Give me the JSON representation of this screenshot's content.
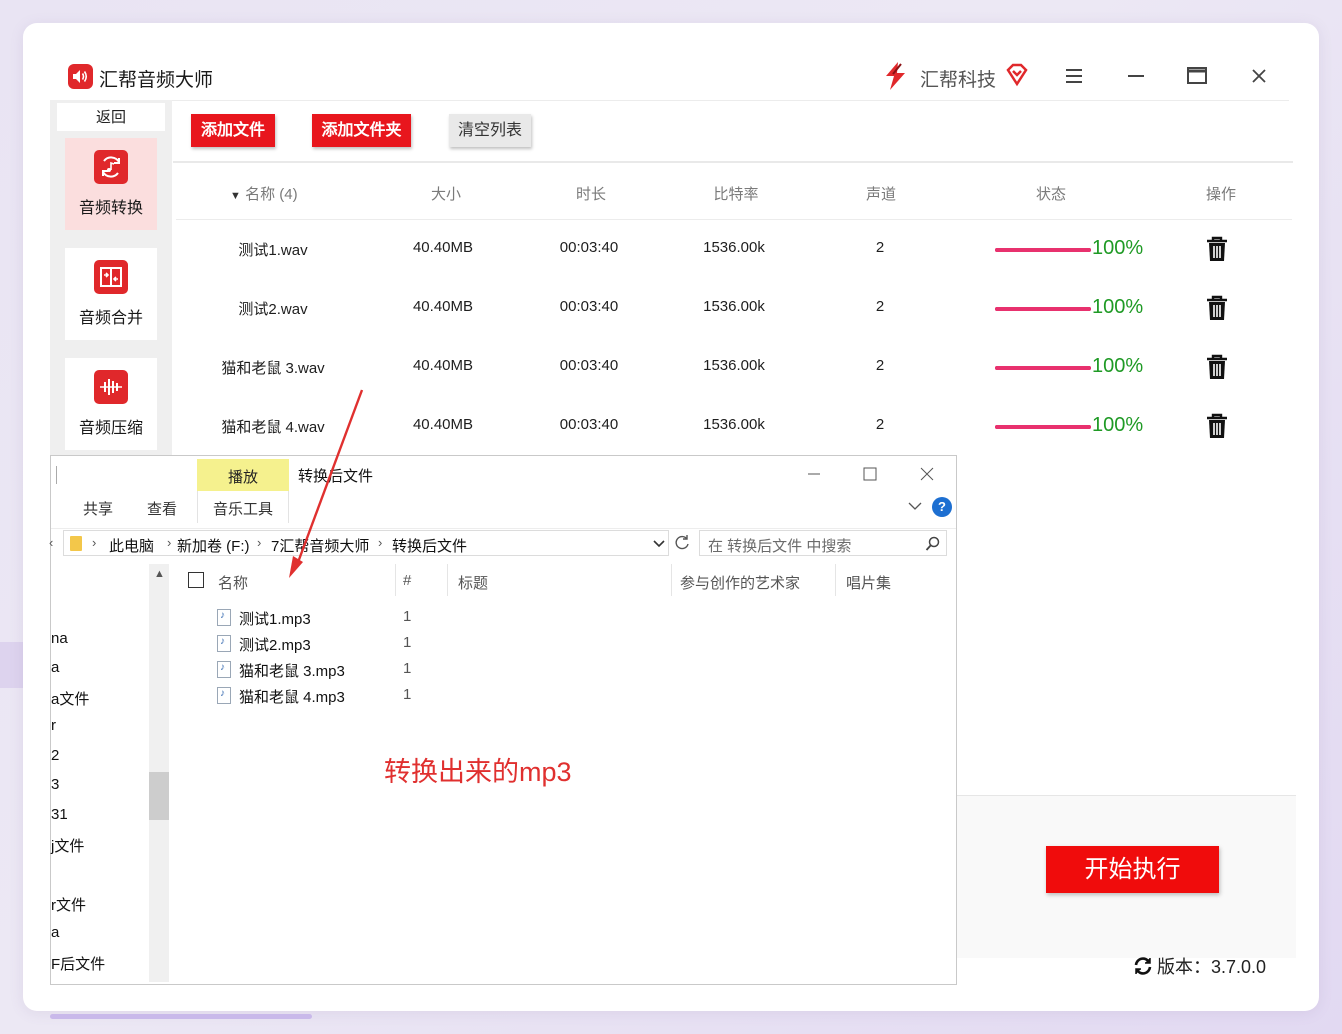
{
  "app": {
    "title": "汇帮音频大师",
    "brand": "汇帮科技",
    "colors": {
      "accent": "#e8161d",
      "progress": "#e8316e",
      "progress_text": "#1f9a25"
    }
  },
  "sidebar": {
    "back": "返回",
    "items": [
      {
        "label": "音频转换",
        "icon": "audio-convert-icon",
        "active": true
      },
      {
        "label": "音频合并",
        "icon": "audio-merge-icon",
        "active": false
      },
      {
        "label": "音频压缩",
        "icon": "audio-compress-icon",
        "active": false
      }
    ]
  },
  "toolbar": {
    "add_file": "添加文件",
    "add_folder": "添加文件夹",
    "clear_list": "清空列表"
  },
  "table": {
    "headers": {
      "name": "名称 (4)",
      "size": "大小",
      "duration": "时长",
      "bitrate": "比特率",
      "channels": "声道",
      "status": "状态",
      "action": "操作"
    },
    "rows": [
      {
        "name": "测试1.wav",
        "size": "40.40MB",
        "duration": "00:03:40",
        "bitrate": "1536.00k",
        "channels": "2",
        "progress": 100,
        "progress_text": "100%"
      },
      {
        "name": "测试2.wav",
        "size": "40.40MB",
        "duration": "00:03:40",
        "bitrate": "1536.00k",
        "channels": "2",
        "progress": 100,
        "progress_text": "100%"
      },
      {
        "name": "猫和老鼠 3.wav",
        "size": "40.40MB",
        "duration": "00:03:40",
        "bitrate": "1536.00k",
        "channels": "2",
        "progress": 100,
        "progress_text": "100%"
      },
      {
        "name": "猫和老鼠 4.wav",
        "size": "40.40MB",
        "duration": "00:03:40",
        "bitrate": "1536.00k",
        "channels": "2",
        "progress": 100,
        "progress_text": "100%"
      }
    ]
  },
  "footer": {
    "start": "开始执行",
    "version": "版本：3.7.0.0"
  },
  "explorer": {
    "play_tab": "播放",
    "title": "转换后文件",
    "ribbon": {
      "share": "共享",
      "view": "查看",
      "music_tools": "音乐工具"
    },
    "breadcrumb": [
      "此电脑",
      "新加卷 (F:)",
      "7汇帮音频大师",
      "转换后文件"
    ],
    "search_placeholder": "在 转换后文件 中搜索",
    "nav_items": [
      "na",
      "a",
      "a文件",
      "r",
      "2",
      "3",
      "31",
      "j文件",
      "",
      "r文件",
      "a",
      "F后文件"
    ],
    "columns": {
      "name": "名称",
      "number": "#",
      "title": "标题",
      "artist": "参与创作的艺术家",
      "album": "唱片集"
    },
    "files": [
      {
        "name": "测试1.mp3",
        "number": "1"
      },
      {
        "name": "测试2.mp3",
        "number": "1"
      },
      {
        "name": "猫和老鼠 3.mp3",
        "number": "1"
      },
      {
        "name": "猫和老鼠 4.mp3",
        "number": "1"
      }
    ]
  },
  "annotation": "转换出来的mp3"
}
